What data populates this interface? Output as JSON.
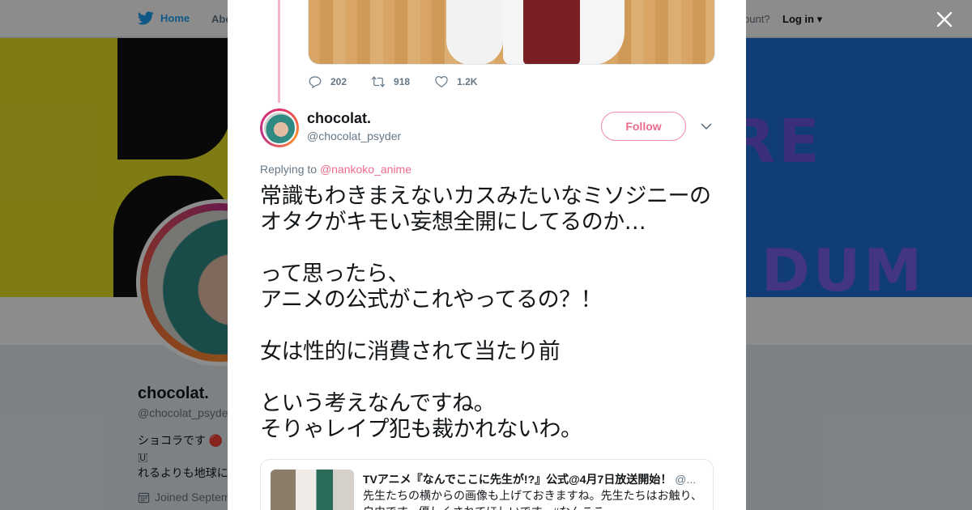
{
  "nav": {
    "home_label": "Home",
    "about_label": "Abo",
    "account_prompt": "ccount?",
    "login_label": "Log in"
  },
  "banner": {
    "text_1": "RE",
    "text_2": "DUM"
  },
  "profile_bg": {
    "name": "chocolat.",
    "handle": "@chocolat_psyde",
    "bio": "ショコラです 🔴 🇺\nれるよりも地球に\nさんはブロック 💆",
    "joined": "Joined Septem"
  },
  "prev_tweet": {
    "replies": "202",
    "retweets": "918",
    "likes": "1.2K"
  },
  "tweet": {
    "author_name": "chocolat.",
    "author_handle": "@chocolat_psyder",
    "follow_label": "Follow",
    "replying_prefix": "Replying to",
    "replying_to": "@nankoko_anime",
    "text": "常識もわきまえないカスみたいなミソジニーのオタクがキモい妄想全開にしてるのか…\n\nって思ったら、\nアニメの公式がこれやってるの？！\n\n女は性的に消費されて当たり前\n\nという考えなんですね。\nそりゃレイプ犯も裁かれないわ。"
  },
  "quote": {
    "name": "TVアニメ『なんでここに先生が!?』公式@4月7日放送開始！",
    "handle": "@...",
    "text": "先生たちの横からの画像も上げておきますね。先生たちはお触り、自由です。優しくされてほしいです。#なんここ"
  },
  "colors": {
    "brand": "#1da1f2",
    "accent": "#ec6b8c",
    "thread_line": "#f5b7c6",
    "muted": "#657786"
  },
  "icons": {
    "close": "close-icon",
    "reply": "reply-icon",
    "retweet": "retweet-icon",
    "like": "heart-icon",
    "more": "chevron-down-icon",
    "calendar": "calendar-icon",
    "logo": "twitter-bird-icon"
  }
}
